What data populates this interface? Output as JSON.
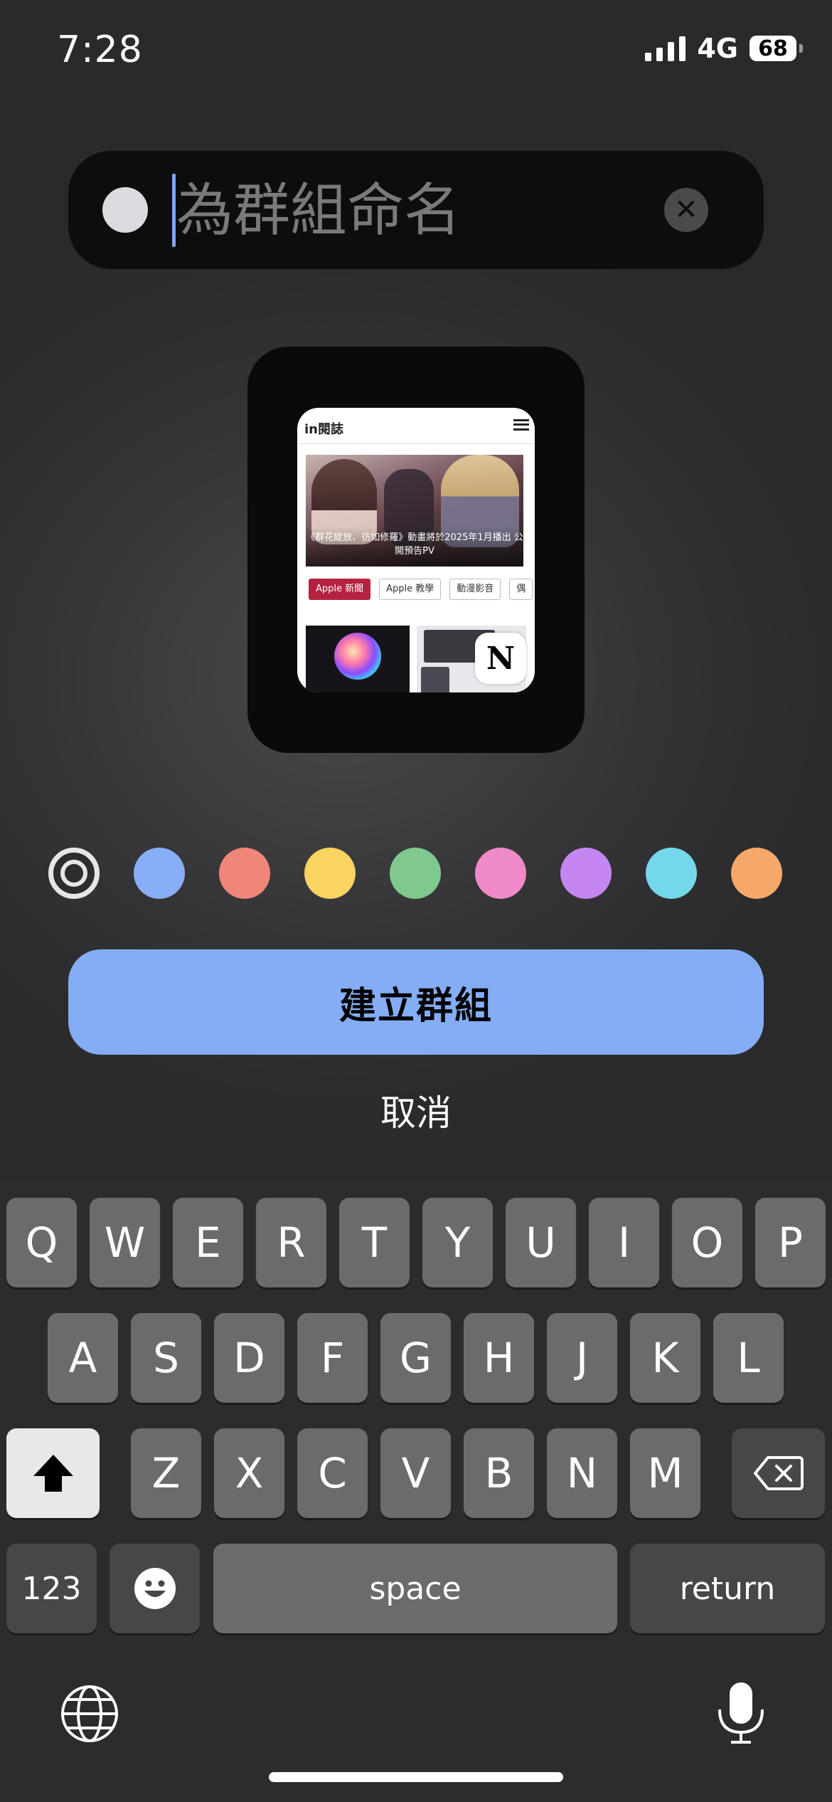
{
  "status_bar": {
    "time": "7:28",
    "network": "4G",
    "battery": "68"
  },
  "group_name": {
    "placeholder": "為群組命名",
    "value": ""
  },
  "preview": {
    "site_logo": "in閱誌",
    "headline": "《群花綻放、彷如修羅》動畫將於2025年1月播出 公開預告PV",
    "tags": [
      "Apple 新聞",
      "Apple 教學",
      "動漫影音",
      "偶"
    ],
    "app_badge": "N"
  },
  "colors": {
    "swatches": [
      "none",
      "#87aef7",
      "#f0857a",
      "#f9d45e",
      "#7fc98f",
      "#f08ac8",
      "#c487f2",
      "#74d8ea",
      "#f5a86a"
    ],
    "selected_index": 0
  },
  "actions": {
    "create": "建立群組",
    "cancel": "取消"
  },
  "keyboard": {
    "row1": [
      "Q",
      "W",
      "E",
      "R",
      "T",
      "Y",
      "U",
      "I",
      "O",
      "P"
    ],
    "row2": [
      "A",
      "S",
      "D",
      "F",
      "G",
      "H",
      "J",
      "K",
      "L"
    ],
    "row3": [
      "Z",
      "X",
      "C",
      "V",
      "B",
      "N",
      "M"
    ],
    "numbers": "123",
    "space": "space",
    "return": "return"
  }
}
